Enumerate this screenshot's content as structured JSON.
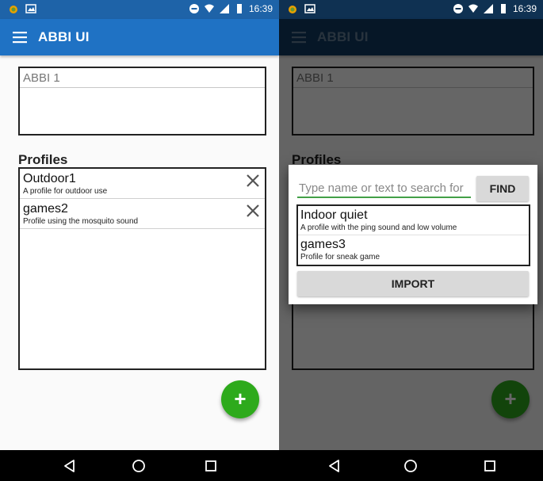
{
  "status_bar": {
    "time": "16:39"
  },
  "app_bar": {
    "title": "ABBI UI",
    "menu_icon": "hamburger-menu-icon"
  },
  "device_name": {
    "value": "ABBI 1"
  },
  "profiles": {
    "title": "Profiles",
    "items": [
      {
        "name": "Outdoor1",
        "description": "A profile for outdoor use"
      },
      {
        "name": "games2",
        "description": "Profile using the mosquito sound"
      }
    ]
  },
  "fab": {
    "label": "+",
    "icon": "add-icon"
  },
  "import_dialog": {
    "search_placeholder": "Type name or text to search for",
    "find_label": "FIND",
    "import_label": "IMPORT",
    "results": [
      {
        "name": "Indoor quiet",
        "description": "A profile with the ping sound and low volume"
      },
      {
        "name": "games3",
        "description": "Profile for sneak game"
      }
    ]
  },
  "colors": {
    "app_bar": "#1f72c4",
    "status_bar": "#1e63a8",
    "fab": "#2eaa1c",
    "input_underline": "#43a047"
  }
}
